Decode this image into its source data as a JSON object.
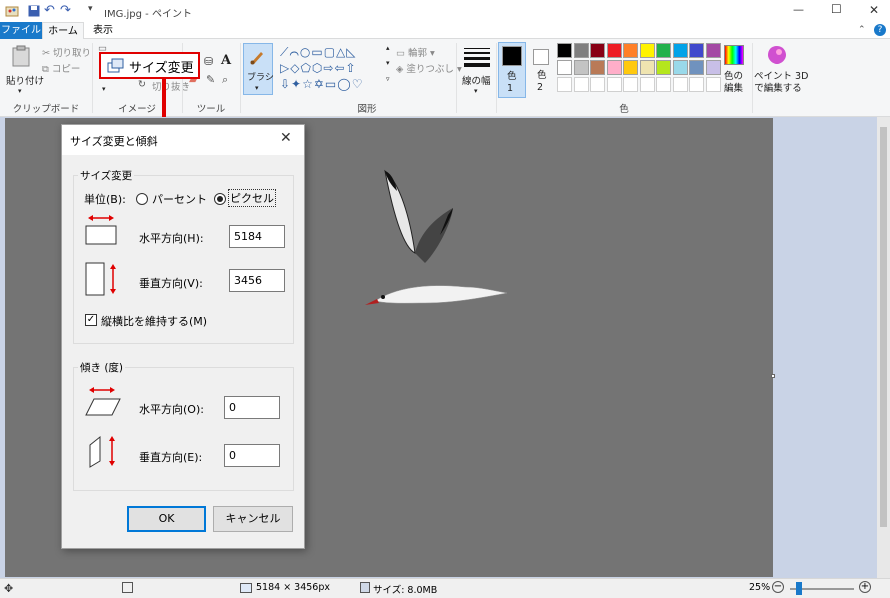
{
  "window": {
    "title": "IMG.jpg - ペイント",
    "controls": {
      "minimize": "—",
      "maximize": "☐",
      "close": "✕"
    }
  },
  "tabs": [
    {
      "label": "ファイル",
      "active": false,
      "file": true
    },
    {
      "label": "ホーム",
      "active": true
    },
    {
      "label": "表示",
      "active": false
    }
  ],
  "ribbon": {
    "clipboard": {
      "paste": "貼り付け",
      "cut": "切り取り",
      "copy": "コピー",
      "group": "クリップボード"
    },
    "image": {
      "select": "選択",
      "resize_callout": "サイズ変更",
      "crop": "切り抜き",
      "rotate": "回転",
      "group": "イメージ"
    },
    "tools": {
      "group": "ツール"
    },
    "brush": {
      "label": "ブラシ"
    },
    "shapes": {
      "outline": "輪郭",
      "fill": "塗りつぶし",
      "group": "図形"
    },
    "size": {
      "label": "線の幅"
    },
    "color1": {
      "label": "色\n1"
    },
    "color2": {
      "label": "色\n2"
    },
    "colors_group": "色",
    "edit_colors": "色の\n編集",
    "paint3d": "ペイント 3D\nで編集する"
  },
  "palette": [
    "#000000",
    "#7f7f7f",
    "#880015",
    "#ed1c24",
    "#ff7f27",
    "#fff200",
    "#22b14c",
    "#00a2e8",
    "#3f48cc",
    "#a349a4",
    "#ffffff",
    "#c3c3c3",
    "#b97a57",
    "#ffaec9",
    "#ffc90e",
    "#efe4b0",
    "#b5e61d",
    "#99d9ea",
    "#7092be",
    "#c8bfe7"
  ],
  "dialog": {
    "title": "サイズ変更と傾斜",
    "resize": {
      "legend": "サイズ変更",
      "unit_label": "単位(B):",
      "percent": "パーセント",
      "pixel": "ピクセル",
      "horizontal_label": "水平方向(H):",
      "horizontal_value": "5184",
      "vertical_label": "垂直方向(V):",
      "vertical_value": "3456",
      "keep_ratio": "縦横比を維持する(M)"
    },
    "skew": {
      "legend": "傾き (度)",
      "horizontal_label": "水平方向(O):",
      "horizontal_value": "0",
      "vertical_label": "垂直方向(E):",
      "vertical_value": "0"
    },
    "ok": "OK",
    "cancel": "キャンセル"
  },
  "status": {
    "dimensions": "5184 × 3456px",
    "size": "サイズ: 8.0MB",
    "zoom": "25%"
  },
  "accent": "#e00000"
}
